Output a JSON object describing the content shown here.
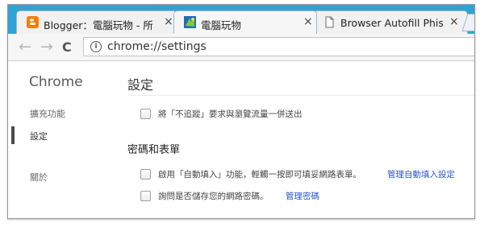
{
  "tabs": [
    {
      "label": "Blogger：電腦玩物 - 所",
      "close": "×",
      "favicon": "blogger-icon",
      "active": false
    },
    {
      "label": "電腦玩物",
      "close": "×",
      "favicon": "site-icon",
      "active": true
    },
    {
      "label": "Browser Autofill Phishir",
      "close": "×",
      "favicon": "page-icon",
      "active": false
    }
  ],
  "toolbar": {
    "back": "←",
    "forward": "→",
    "reload": "C",
    "url": "chrome://settings"
  },
  "sidebar": {
    "title": "Chrome",
    "items": [
      {
        "label": "擴充功能"
      },
      {
        "label": "設定"
      },
      {
        "label": "關於"
      }
    ]
  },
  "main": {
    "title": "設定",
    "dnt_text": "將「不追蹤」要求與瀏覽流量一併送出",
    "section_title": "密碼和表單",
    "autofill_text": "啟用「自動填入」功能，輕觸一按即可填妥網路表單。",
    "autofill_link": "管理自動填入設定",
    "passwords_text": "詢問是否儲存您的網路密碼。",
    "passwords_link": "管理密碼"
  },
  "colors": {
    "tabstrip": "#2fa3d6",
    "link": "#2a56c6",
    "blogger": "#f57d00"
  }
}
